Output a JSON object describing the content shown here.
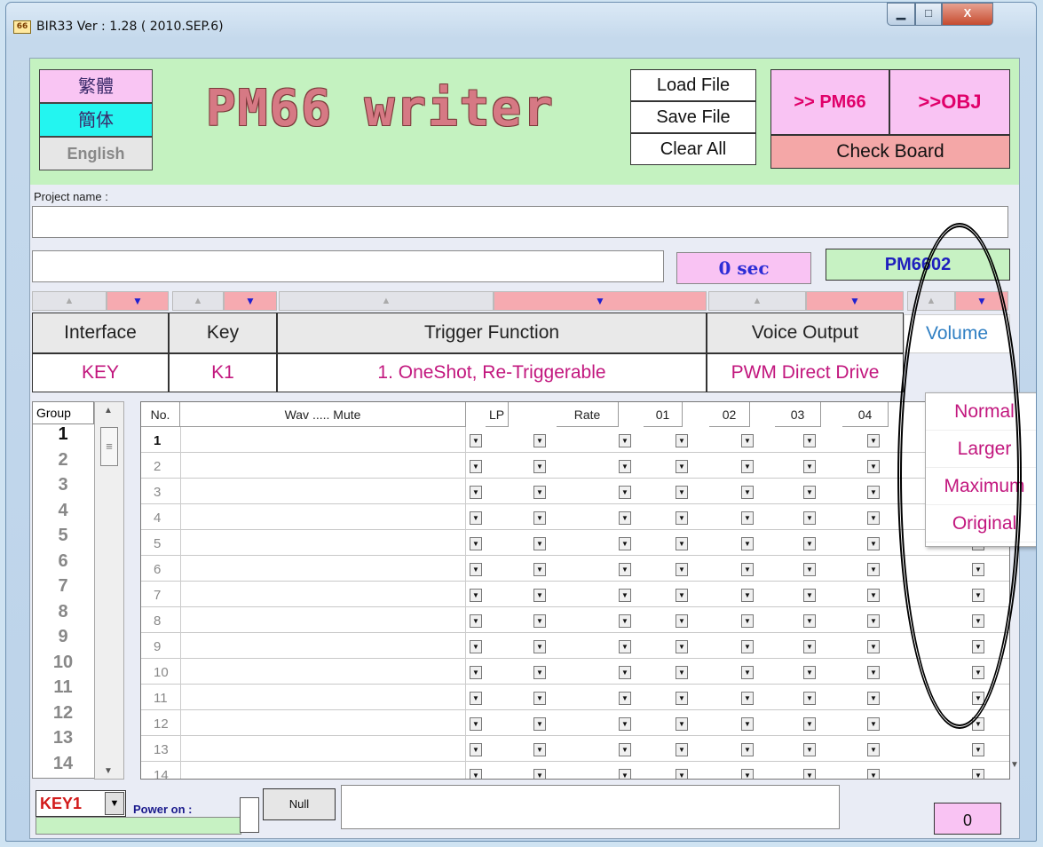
{
  "window": {
    "title": "BIR33 Ver : 1.28 ( 2010.SEP.6)",
    "icon_label": "66",
    "min_glyph": "▁",
    "max_glyph": "□",
    "close_glyph": "X"
  },
  "lang": {
    "traditional": "繁體",
    "simplified": "簡体",
    "english": "English"
  },
  "logo": "PM66 writer",
  "toolbar": {
    "load": "Load File",
    "save": "Save File",
    "clear": "Clear All",
    "to_pm66": ">> PM66",
    "to_obj": ">>OBJ",
    "check_board": "Check Board"
  },
  "project": {
    "label": "Project name :",
    "value": ""
  },
  "status": {
    "time": "0 sec",
    "chip": "PM6602"
  },
  "headers": {
    "interface": "Interface",
    "key": "Key",
    "trigger": "Trigger Function",
    "voice": "Voice Output",
    "volume": "Volume"
  },
  "values": {
    "interface": "KEY",
    "key": "K1",
    "trigger": "1. OneShot, Re-Triggerable",
    "voice": "PWM Direct Drive"
  },
  "volume_options": [
    "Normal",
    "Larger",
    "Maximum",
    "Original"
  ],
  "groups": {
    "header": "Group",
    "items": [
      "1",
      "2",
      "3",
      "4",
      "5",
      "6",
      "7",
      "8",
      "9",
      "10",
      "11",
      "12",
      "13",
      "14"
    ]
  },
  "table": {
    "columns": [
      "No.",
      "Wav ..... Mute",
      "LP",
      "Rate",
      "01",
      "02",
      "03",
      "04"
    ],
    "rows": [
      "1",
      "2",
      "3",
      "4",
      "5",
      "6",
      "7",
      "8",
      "9",
      "10",
      "11",
      "12",
      "13",
      "14"
    ]
  },
  "bottom": {
    "key_select": "KEY1",
    "power_on": "Power on :",
    "null_btn": "Null",
    "count": "0"
  },
  "colors": {
    "accent_pink": "#f9c3f3",
    "accent_green": "#c4f2c0",
    "magenta_text": "#c2177e"
  }
}
